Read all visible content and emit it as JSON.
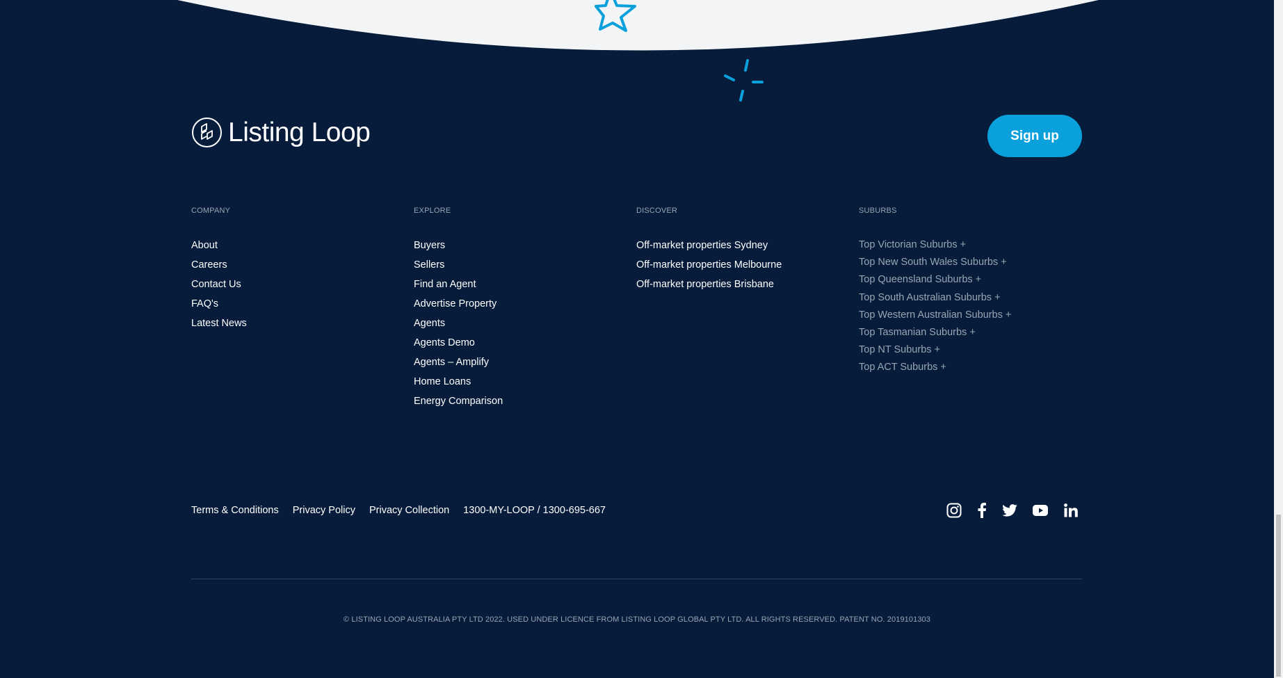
{
  "brand": {
    "name": "Listing Loop"
  },
  "header": {
    "signup_label": "Sign up"
  },
  "columns": {
    "company": {
      "heading": "COMPANY",
      "links": [
        "About",
        "Careers",
        "Contact Us",
        "FAQ's",
        "Latest News"
      ]
    },
    "explore": {
      "heading": "EXPLORE",
      "links": [
        "Buyers",
        "Sellers",
        "Find an Agent",
        "Advertise Property",
        "Agents",
        "Agents Demo",
        "Agents – Amplify",
        "Home Loans",
        "Energy Comparison"
      ]
    },
    "discover": {
      "heading": "DISCOVER",
      "links": [
        "Off-market properties Sydney",
        "Off-market properties Melbourne",
        "Off-market properties Brisbane"
      ]
    },
    "suburbs": {
      "heading": "SUBURBS",
      "links": [
        "Top Victorian Suburbs +",
        "Top New South Wales Suburbs +",
        "Top Queensland Suburbs +",
        "Top South Australian Suburbs +",
        "Top Western Australian Suburbs +",
        "Top Tasmanian Suburbs +",
        "Top NT Suburbs +",
        "Top ACT Suburbs +"
      ]
    }
  },
  "legal": {
    "terms": "Terms & Conditions",
    "privacy_policy": "Privacy Policy",
    "privacy_collection": "Privacy Collection",
    "phone": "1300-MY-LOOP / 1300-695-667"
  },
  "social": [
    "instagram-icon",
    "facebook-icon",
    "twitter-icon",
    "youtube-icon",
    "linkedin-icon"
  ],
  "copyright": "© LISTING LOOP AUSTRALIA PTY LTD 2022. USED UNDER LICENCE FROM LISTING LOOP GLOBAL PTY LTD. ALL RIGHTS RESERVED. PATENT NO. 2019101303",
  "colors": {
    "background": "#061c3a",
    "accent": "#0aa0dc",
    "muted": "#9aa5b4",
    "curve": "#f3f4f5"
  }
}
